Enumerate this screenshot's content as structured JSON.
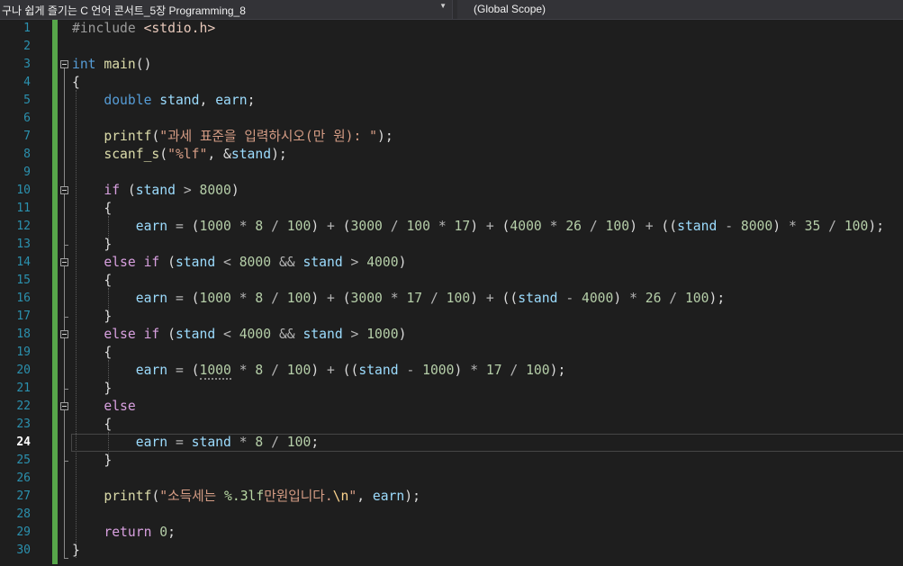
{
  "toolbar": {
    "project_dropdown": "구나 쉽게 즐기는 C 언어 콘서트_5장 Programming_8",
    "scope_dropdown": "(Global Scope)"
  },
  "editor": {
    "current_line": "24",
    "line_numbers": [
      "1",
      "2",
      "3",
      "4",
      "5",
      "6",
      "7",
      "8",
      "9",
      "10",
      "11",
      "12",
      "13",
      "14",
      "15",
      "16",
      "17",
      "18",
      "19",
      "20",
      "21",
      "22",
      "23",
      "24",
      "25",
      "26",
      "27",
      "28",
      "29",
      "30"
    ],
    "tokens": {
      "include_directive": "#include",
      "header": "<stdio.h>",
      "int": "int",
      "main": "main",
      "double": "double",
      "stand": "stand",
      "earn": "earn",
      "printf": "printf",
      "scanf_s": "scanf_s",
      "if": "if",
      "else": "else",
      "return": "return",
      "prompt_string": "\"과세 표준을 입력하시오(만 원): \"",
      "fmt_lf_string": "\"%lf\"",
      "result_string_pre": "\"소득세는 ",
      "result_fmt": "%.3lf",
      "result_string_mid": "만원입니다.",
      "newline_escape": "\\n",
      "quote": "\"",
      "n8000": "8000",
      "n4000": "4000",
      "n1000": "1000",
      "n3000": "3000",
      "n8": "8",
      "n100": "100",
      "n17": "17",
      "n26": "26",
      "n35": "35",
      "n0": "0"
    }
  }
}
